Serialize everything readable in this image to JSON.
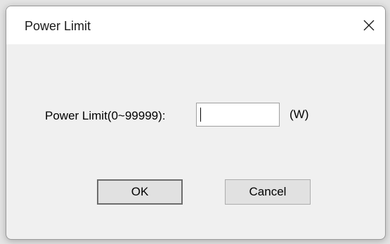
{
  "dialog": {
    "title": "Power Limit",
    "close_icon": "close-icon"
  },
  "form": {
    "label": "Power Limit(0~99999):",
    "value": "",
    "unit": "(W)"
  },
  "buttons": {
    "ok_label": "OK",
    "cancel_label": "Cancel"
  }
}
